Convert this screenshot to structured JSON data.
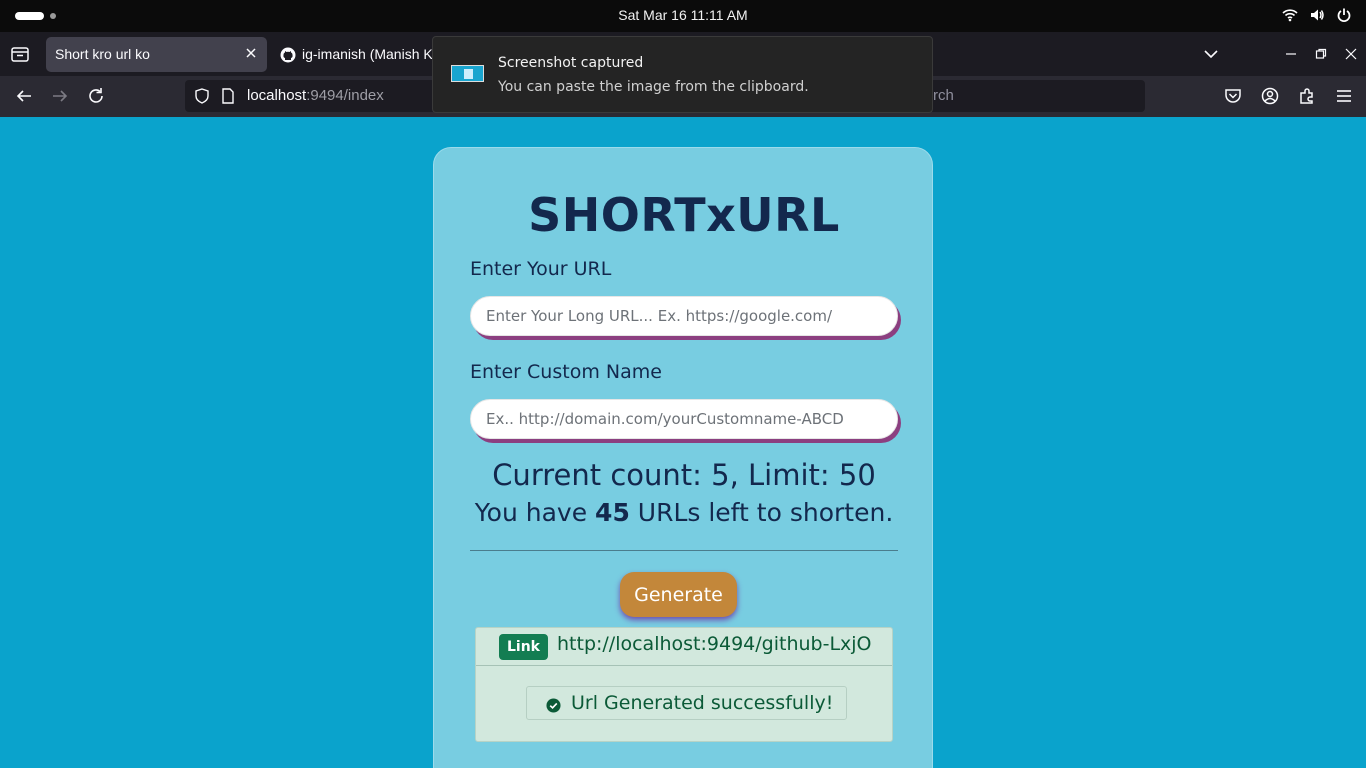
{
  "system_bar": {
    "clock": "Sat Mar 16  11:11 AM",
    "icons": [
      "wifi-icon",
      "volume-icon",
      "power-icon"
    ]
  },
  "browser": {
    "tabs": [
      {
        "title": "Short kro url ko",
        "active": true
      },
      {
        "title": "ig-imanish (Manish K",
        "active": false,
        "icon": "github-icon"
      }
    ],
    "url_host": "localhost",
    "url_path": ":9494/index",
    "search_placeholder": "rch"
  },
  "notification": {
    "title": "Screenshot captured",
    "body": "You can paste the image from the clipboard."
  },
  "app": {
    "title": "SHORTxURL",
    "url_label": "Enter Your URL",
    "url_placeholder": "Enter Your Long URL... Ex. https://google.com/",
    "custom_label": "Enter Custom Name",
    "custom_placeholder": "Ex.. http://domain.com/yourCustomname-ABCD",
    "count_text": "Current count: 5, Limit: 50",
    "left_prefix": "You have ",
    "left_count": "45",
    "left_suffix": " URLs left to shorten.",
    "generate_label": "Generate",
    "link_badge": "Link",
    "short_link": "http://localhost:9494/github-LxjO",
    "success_message": "Url Generated successfully!"
  },
  "colors": {
    "page_bg": "#0aa3cc",
    "card_bg": "#78cde1",
    "title_text": "#13284d",
    "button_bg": "#c3873a",
    "input_shadow": "#8c3f80",
    "success_bg": "#d2e8dd",
    "badge_bg": "#137d52"
  }
}
